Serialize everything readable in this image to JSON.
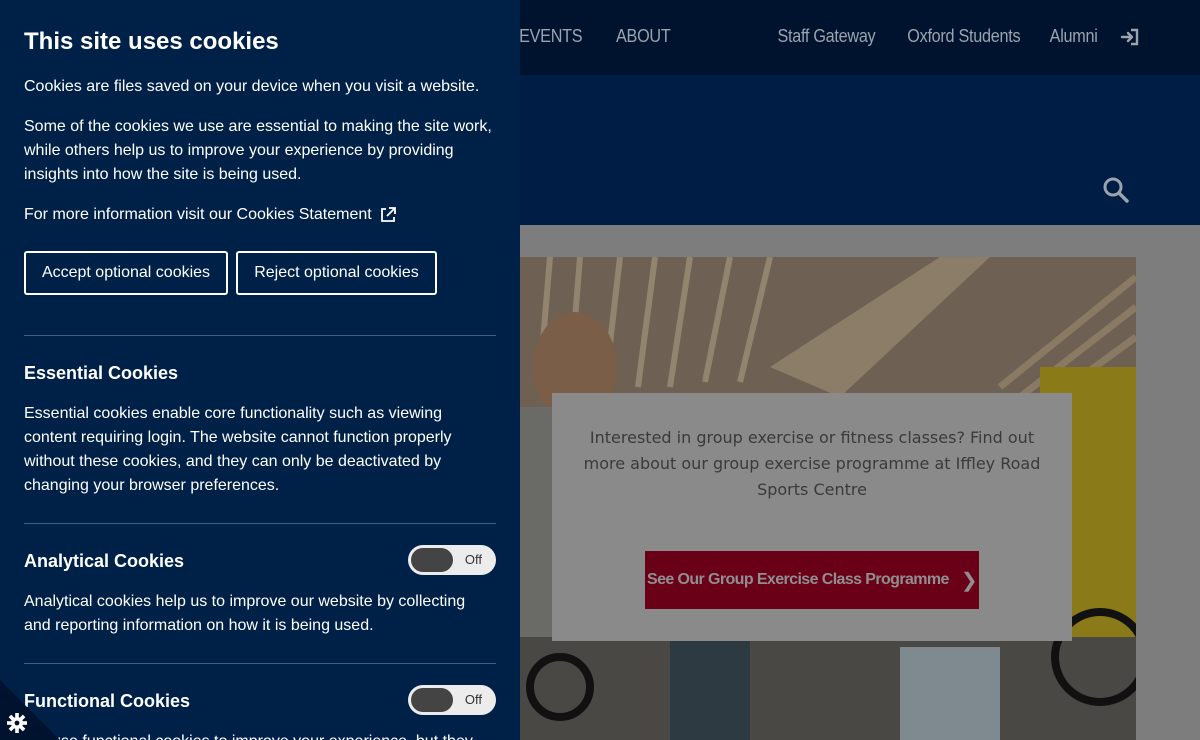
{
  "site": {
    "nav_left": [
      "& EVENTS",
      "ABOUT"
    ],
    "nav_right": [
      "Staff Gateway",
      "Oxford Students",
      "Alumni"
    ],
    "hero_text": "Interested in group exercise or fitness classes? Find out more about our group exercise programme at Iffley Road Sports Centre",
    "hero_cta": "See Our Group Exercise Class Programme",
    "icons": {
      "login": "sign-in-icon",
      "search": "search-icon",
      "cta_arrow": "chevron-right-icon"
    }
  },
  "cookies": {
    "title": "This site uses cookies",
    "intro": "Cookies are files saved on your device when you visit a website.",
    "paragraph": "Some of the cookies we use are essential to making the site work, while others help us to improve your experience by providing insights into how the site is being used.",
    "more_info": "For more information visit our Cookies Statement",
    "accept_label": "Accept optional cookies",
    "reject_label": "Reject optional cookies",
    "sections": [
      {
        "title": "Essential Cookies",
        "description": "Essential cookies enable core functionality such as viewing content requiring login. The website cannot function properly without these cookies, and they can only be deactivated by changing your browser preferences."
      },
      {
        "title": "Analytical Cookies",
        "description": "Analytical cookies help us to improve our website by collecting and reporting information on how it is being used.",
        "toggle": "Off"
      },
      {
        "title": "Functional Cookies",
        "description": "We use functional cookies to improve your experience, but they",
        "toggle": "Off"
      }
    ],
    "icons": {
      "external_link": "external-link-icon",
      "settings": "gear-icon"
    }
  },
  "colors": {
    "panel_bg": "#002147",
    "header_bg": "#001d45",
    "cta_bg": "#6a0018"
  }
}
